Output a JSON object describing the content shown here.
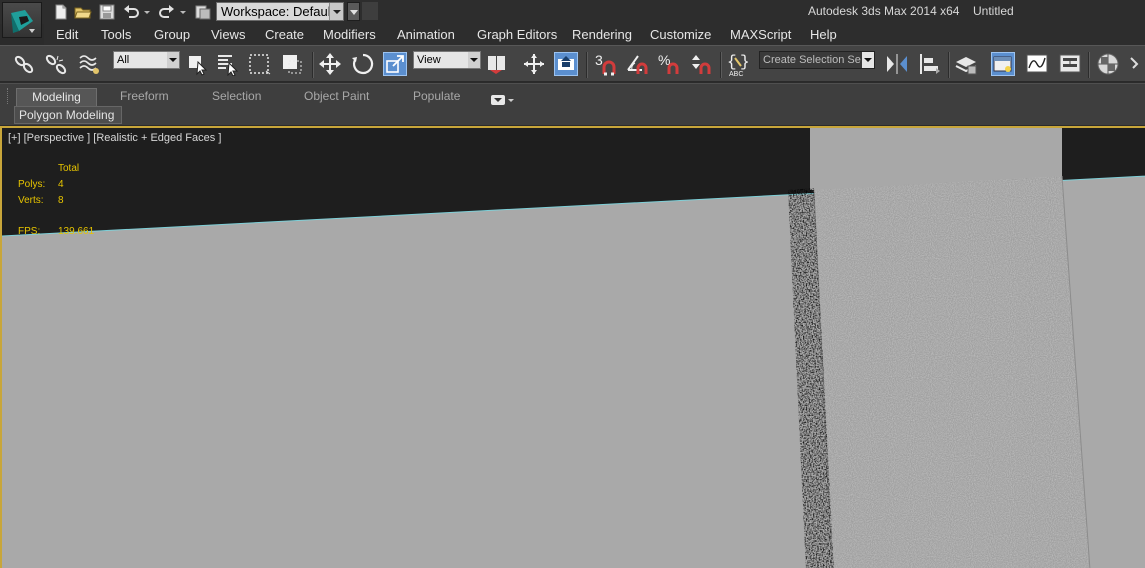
{
  "titlebar": {
    "workspace_label": "Workspace: Default",
    "app_title": "Autodesk 3ds Max  2014 x64",
    "doc_title": "Untitled"
  },
  "menu": {
    "items": [
      "Edit",
      "Tools",
      "Group",
      "Views",
      "Create",
      "Modifiers",
      "Animation",
      "Graph Editors",
      "Rendering",
      "Customize",
      "MAXScript",
      "Help"
    ]
  },
  "toolbar": {
    "selection_filter": "All",
    "reference_coord": "View",
    "named_selection_placeholder": "Create Selection Se",
    "snap_label": "3",
    "percent_snap_label": "%",
    "edit_named_label": "ABC"
  },
  "ribbon": {
    "tabs": [
      "Modeling",
      "Freeform",
      "Selection",
      "Object Paint",
      "Populate"
    ],
    "panel": "Polygon Modeling"
  },
  "viewport": {
    "label": "[+] [Perspective ] [Realistic + Edged Faces ]",
    "stats": {
      "header": "Total",
      "polys_label": "Polys:",
      "polys_value": "4",
      "verts_label": "Verts:",
      "verts_value": "8",
      "fps_label": "FPS:",
      "fps_value": "139.661"
    }
  },
  "colors": {
    "viewport_frame": "#c8a63a",
    "stats_text": "#e7c400",
    "active_tool": "#5b8fcf"
  }
}
